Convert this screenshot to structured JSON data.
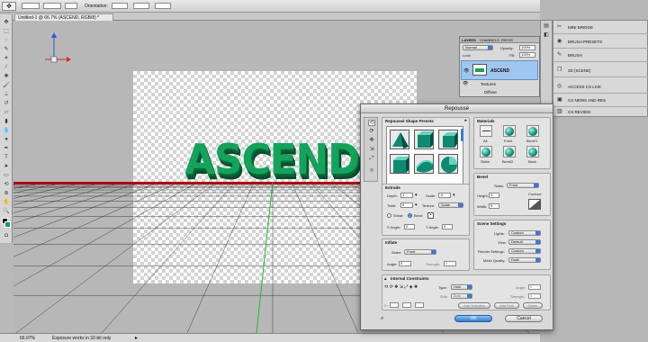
{
  "options_bar": {
    "orientation_label": "Orientation:"
  },
  "document_tab": {
    "title": "Untitled-1 @ 66.7% (ASCEND, RGB/8) *"
  },
  "canvas": {
    "text3d": "ASCEND",
    "text_color": "#13a35a"
  },
  "status": {
    "zoom": "66.67%",
    "message": "Exposure works in 32-bit only"
  },
  "layers_panel": {
    "tabs": [
      "LAYERS",
      "CHANNELS",
      "PATHS"
    ],
    "blend_mode": "Normal",
    "opacity_label": "Opacity:",
    "opacity": "100%",
    "lock_label": "Lock:",
    "fill_label": "Fill:",
    "fill": "100%",
    "layer_name": "ASCEND",
    "sublayers": [
      "Textures",
      "Diffuse"
    ]
  },
  "dock": {
    "top_items": [
      "MINI BRIDGE",
      "BRUSH PRESETS",
      "BRUSH",
      "3D {SCENE}"
    ],
    "bottom_items": [
      "ACCESS CS LIVE",
      "CS NEWS AND RES",
      "CS REVIEW"
    ],
    "top_icons": [
      "scissors-icon",
      "palette-icon",
      "brush-icon",
      "cube-icon"
    ],
    "bottom_icons": [
      "live-icon",
      "news-icon",
      "review-icon"
    ]
  },
  "dialog": {
    "title": "Repoussé",
    "shape_presets": {
      "title": "Repoussé Shape Presets"
    },
    "materials": {
      "title": "Materials",
      "labels": [
        "All",
        "Front",
        "Bevel1",
        "Sides",
        "Bevel2",
        "Back"
      ]
    },
    "extrude": {
      "title": "Extrude",
      "depth_label": "Depth:",
      "depth": "1",
      "scale_label": "Scale:",
      "scale": ".5",
      "twist_label": "Twist:",
      "twist": "0",
      "texture_label": "Texture:",
      "texture": "Scale",
      "shear_label": "Shear",
      "bend_label": "Bend",
      "xangle_label": "X Angle:",
      "xangle": "0",
      "yangle_label": "Y Angle:",
      "yangle": "0"
    },
    "bevel": {
      "title": "Bevel",
      "sides_label": "Sides:",
      "sides": "Front",
      "height_label": "Height:",
      "height": "0",
      "width_label": "Width:",
      "width": "0",
      "contour_label": "Contour:"
    },
    "inflate": {
      "title": "Inflate",
      "sides_label": "Sides:",
      "sides": "Front",
      "angle_label": "Angle:",
      "angle": "0",
      "strength_label": "Strength:",
      "strength": "0"
    },
    "scene_settings": {
      "title": "Scene Settings",
      "lights_label": "Lights:",
      "lights": "Custom",
      "view_label": "View:",
      "view": "Default",
      "render_label": "Render Settings:",
      "render": "Custom",
      "mesh_label": "Mesh Quality:",
      "mesh": "Draft"
    },
    "internal": {
      "title": "Internal Constraints",
      "type_label": "Type:",
      "type": "Hole",
      "side_label": "Side:",
      "side": "Both",
      "angle_label": "Angle:",
      "angle": "0",
      "strength_label": "Strength:",
      "strength": "0",
      "x_label": "X:",
      "add_selection": "Add Selection",
      "add_path": "Add Path",
      "delete": "Delete"
    },
    "ok": "OK",
    "cancel": "Cancel"
  }
}
